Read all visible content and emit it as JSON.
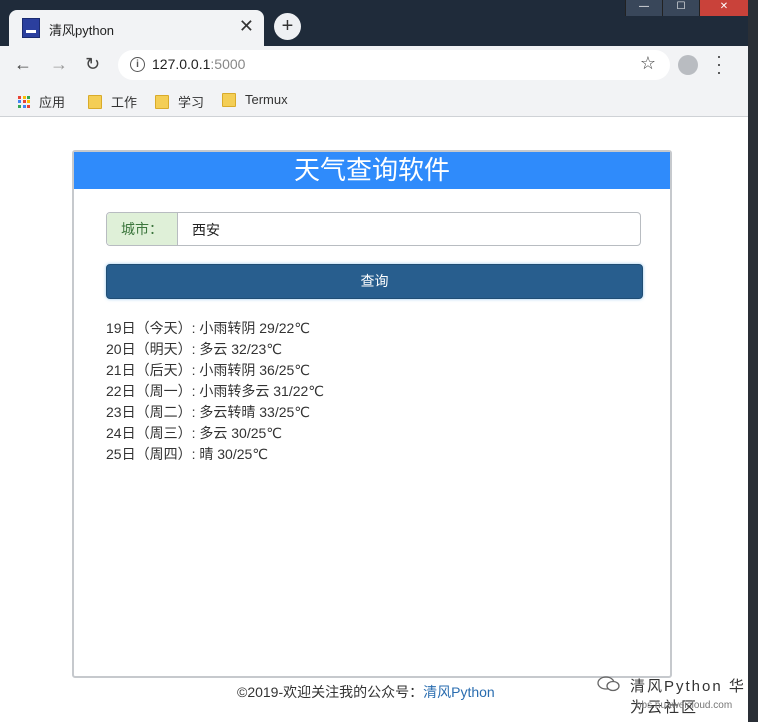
{
  "browser": {
    "tab_title": "清风python",
    "tab_close": "✕",
    "new_tab": "+",
    "url_host": "127.0.0.1",
    "url_port": ":5000",
    "bookmarks": [
      "应用",
      "工作",
      "学习",
      "Termux"
    ],
    "window_buttons": [
      "—",
      "☐",
      "✕"
    ]
  },
  "page": {
    "header_title": "天气查询软件",
    "city_label": "城市：",
    "city_value": "西安",
    "query_button": "查询",
    "results": [
      "19日（今天）: 小雨转阴 29/22℃",
      "20日（明天）: 多云 32/23℃",
      "21日（后天）: 小雨转阴 36/25℃",
      "22日（周一）: 小雨转多云 31/22℃",
      "23日（周二）: 多云转晴 33/25℃",
      "24日（周三）: 多云 30/25℃",
      "25日（周四）: 晴 30/25℃"
    ],
    "footer_text": "©2019-欢迎关注我的公众号：",
    "footer_link": "清风Python"
  },
  "watermark": {
    "text": "清风Python 华为云社区",
    "url": "bbs.huaweicloud.com"
  },
  "colors": {
    "header_bg": "#2f8bfb",
    "button_bg": "#285e8e",
    "addon_bg": "#dff0d8"
  }
}
